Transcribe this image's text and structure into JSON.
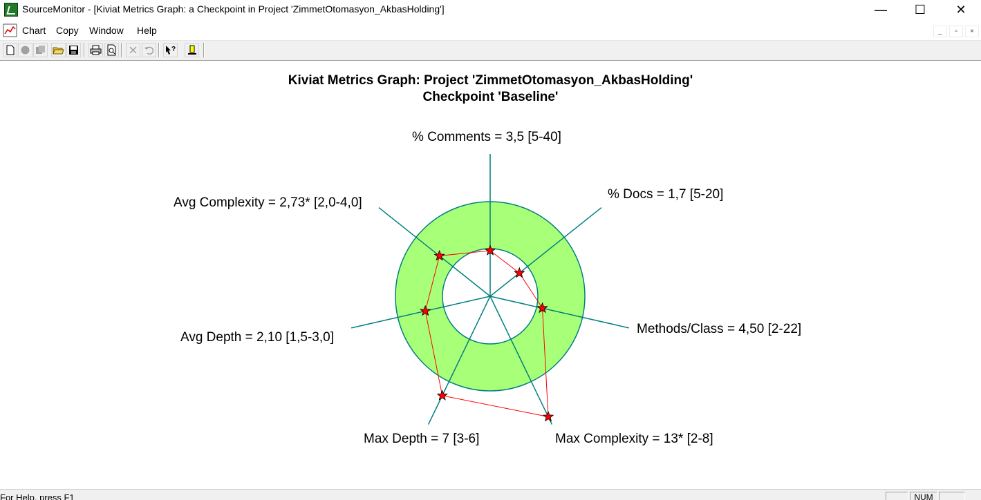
{
  "window": {
    "title": "SourceMonitor - [Kiviat Metrics Graph: a Checkpoint in Project 'ZimmetOtomasyon_AkbasHolding']",
    "minimize_glyph": "—",
    "maximize_glyph": "☐",
    "close_glyph": "✕"
  },
  "menu": {
    "items": [
      "Chart",
      "Copy",
      "Window",
      "Help"
    ],
    "mdi_minimize": "_",
    "mdi_restore": "▫",
    "mdi_close": "×"
  },
  "toolbar": {
    "buttons": [
      "new-icon",
      "stop-icon",
      "copy-icon",
      "open-icon",
      "save-icon",
      "print-icon",
      "print-preview-icon",
      "delete-icon",
      "undo-icon",
      "context-help-icon",
      "marker-icon"
    ]
  },
  "chart": {
    "title_line1": "Kiviat Metrics Graph: Project 'ZimmetOtomasyon_AkbasHolding'",
    "title_line2": "Checkpoint 'Baseline'"
  },
  "chart_data": {
    "type": "radar",
    "title": "Kiviat Metrics Graph: Project 'ZimmetOtomasyon_AkbasHolding' Checkpoint 'Baseline'",
    "axes": [
      {
        "label": "% Comments = 3,5 [5-40]",
        "metric": "% Comments",
        "value": 3.5,
        "range": [
          5,
          40
        ]
      },
      {
        "label": "% Docs = 1,7 [5-20]",
        "metric": "% Docs",
        "value": 1.7,
        "range": [
          5,
          20
        ]
      },
      {
        "label": "Methods/Class = 4,50 [2-22]",
        "metric": "Methods/Class",
        "value": 4.5,
        "range": [
          2,
          22
        ]
      },
      {
        "label": "Max Complexity = 13* [2-8]",
        "metric": "Max Complexity",
        "value": 13,
        "range": [
          2,
          8
        ]
      },
      {
        "label": "Max Depth = 7 [3-6]",
        "metric": "Max Depth",
        "value": 7,
        "range": [
          3,
          6
        ]
      },
      {
        "label": "Avg Depth = 2,10 [1,5-3,0]",
        "metric": "Avg Depth",
        "value": 2.1,
        "range": [
          1.5,
          3.0
        ]
      },
      {
        "label": "Avg Complexity = 2,73* [2,0-4,0]",
        "metric": "Avg Complexity",
        "value": 2.73,
        "range": [
          2.0,
          4.0
        ]
      }
    ],
    "colors": {
      "axis": "#007f7f",
      "band_fill": "#a8ff78",
      "band_stroke": "#007f7f",
      "series_line": "#ff0000",
      "marker_fill": "#ff0000",
      "marker_stroke": "#000000"
    }
  },
  "status": {
    "help_text": "For Help, press F1",
    "num_indicator": "NUM"
  }
}
